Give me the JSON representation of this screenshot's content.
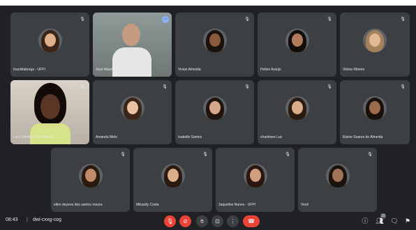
{
  "participants": [
    {
      "name": "Inacildabrega - UFPI",
      "muted": true,
      "skin": "#e0b08a",
      "hair": "#3a2418"
    },
    {
      "name": "José Mauricio Arco Saraiva",
      "muted": false,
      "skin": "#c9a185",
      "hair": "#d9d9d9"
    },
    {
      "name": "Vivian Almeida",
      "muted": true,
      "skin": "#8a5a3c",
      "hair": "#1b120c"
    },
    {
      "name": "Hellen Araújo",
      "muted": true,
      "skin": "#b07c5c",
      "hair": "#140c08"
    },
    {
      "name": "Vitória Ribeiro",
      "muted": true,
      "skin": "#e2b896",
      "hair": "#a3815a"
    },
    {
      "name": "Lara Dandara S.A Gomes",
      "muted": true,
      "skin": "#5a3626",
      "hair": "#120a06"
    },
    {
      "name": "Amanda Melo",
      "muted": true,
      "skin": "#e8c2a2",
      "hair": "#3b2519"
    },
    {
      "name": "Isabelle Santos",
      "muted": true,
      "skin": "#d6a788",
      "hair": "#20140d"
    },
    {
      "name": "charlimee Luz",
      "muted": true,
      "skin": "#d9ad8c",
      "hair": "#2a1a10"
    },
    {
      "name": "Eloine Soares de Almeida",
      "muted": true,
      "skin": "#9c6a4c",
      "hair": "#1a100a"
    },
    {
      "name": "ellen deyene dos santos moura",
      "muted": true,
      "skin": "#c08b6a",
      "hair": "#2a1a10"
    },
    {
      "name": "Mikaelly Costa",
      "muted": true,
      "skin": "#dcae8c",
      "hair": "#2b1a0f"
    },
    {
      "name": "Jaqueline Nunes - UFPI",
      "muted": true,
      "skin": "#d19f80",
      "hair": "#2b1710"
    },
    {
      "name": "Você",
      "muted": true,
      "skin": "#a07358",
      "hair": "#1c120c"
    }
  ],
  "bottom_bar": {
    "time": "08:43",
    "separator": "|",
    "meeting_code": "dwi-cxxg-cog",
    "people_count": "16"
  },
  "colors": {
    "background": "#202124",
    "tile": "#3c4043",
    "accent": "#8ab4f8",
    "danger": "#ea4335"
  },
  "icons": {
    "mic_off": "mic-off-icon",
    "cam_off": "camera-off-icon",
    "raise_hand": "hand-icon",
    "present": "present-icon",
    "more": "more-icon",
    "leave": "phone-hangup-icon",
    "info": "info-icon",
    "people": "people-icon",
    "chat": "chat-icon",
    "activities": "activities-icon"
  }
}
